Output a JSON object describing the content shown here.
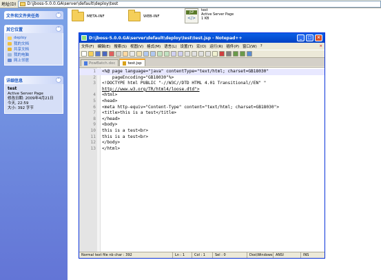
{
  "address": {
    "label": "地址(D)",
    "path": "D:\\jboss-5.0.0.GA\\server\\default\\deploy\\test"
  },
  "sidebar": {
    "tasks": {
      "title": "文件和文件夹任务"
    },
    "places": {
      "title": "其它位置",
      "items": [
        {
          "label": "deploy"
        },
        {
          "label": "我的文档"
        },
        {
          "label": "共享文档"
        },
        {
          "label": "我的电脑"
        },
        {
          "label": "网上邻居"
        }
      ]
    },
    "details": {
      "title": "详细信息",
      "name": "test",
      "type": "Active Server Page",
      "modified": "修改日期: 2009年4月21日",
      "time": "今天, 22:59",
      "size": "大小: 392 字节"
    }
  },
  "files": [
    {
      "name": "META-INF"
    },
    {
      "name": "WEB-INF"
    },
    {
      "name": "test",
      "type": "Active Server Page",
      "size": "1 KB",
      "badge": "JSP"
    }
  ],
  "notepad": {
    "title": "D:\\jboss-5.0.0.GA\\server\\default\\deploy\\test\\test.jsp - Notepad++",
    "menu": [
      "文件(F)",
      "编辑(E)",
      "搜索(S)",
      "视图(V)",
      "格式(M)",
      "语言(L)",
      "设置(T)",
      "宏(O)",
      "运行(R)",
      "插件(P)",
      "窗口(W)",
      "?"
    ],
    "tabs": [
      {
        "label": "PowBatch.doc"
      },
      {
        "label": "test.jsp"
      }
    ],
    "lines": [
      {
        "n": "1",
        "t": "<%@ page language=\"java\" contentType=\"text/html; charset=GB18030\""
      },
      {
        "n": "2",
        "t": "    pageEncoding=\"GB18030\"%>"
      },
      {
        "n": "3",
        "t": "<!DOCTYPE html PUBLIC \"-//W3C//DTD HTML 4.01 Transitional//EN\" \""
      },
      {
        "n": "",
        "t": "http://www.w3.org/TR/html4/loose.dtd\">"
      },
      {
        "n": "4",
        "t": "<html>"
      },
      {
        "n": "5",
        "t": "<head>"
      },
      {
        "n": "6",
        "t": "<meta http-equiv=\"Content-Type\" content=\"text/html; charset=GB18030\">"
      },
      {
        "n": "7",
        "t": "<title>this is a test</title>"
      },
      {
        "n": "8",
        "t": "</head>"
      },
      {
        "n": "9",
        "t": "<body>"
      },
      {
        "n": "10",
        "t": "this is a test<br>"
      },
      {
        "n": "11",
        "t": "this is a test<br>"
      },
      {
        "n": "12",
        "t": "</body>"
      },
      {
        "n": "13",
        "t": "</html>"
      }
    ],
    "status": {
      "type": "Normal text file nb char : 392",
      "ln": "Ln : 1",
      "col": "Col : 1",
      "sel": "Sel : 0",
      "eol": "Dos\\Windows",
      "enc": "ANSI",
      "ins": "INS"
    }
  }
}
